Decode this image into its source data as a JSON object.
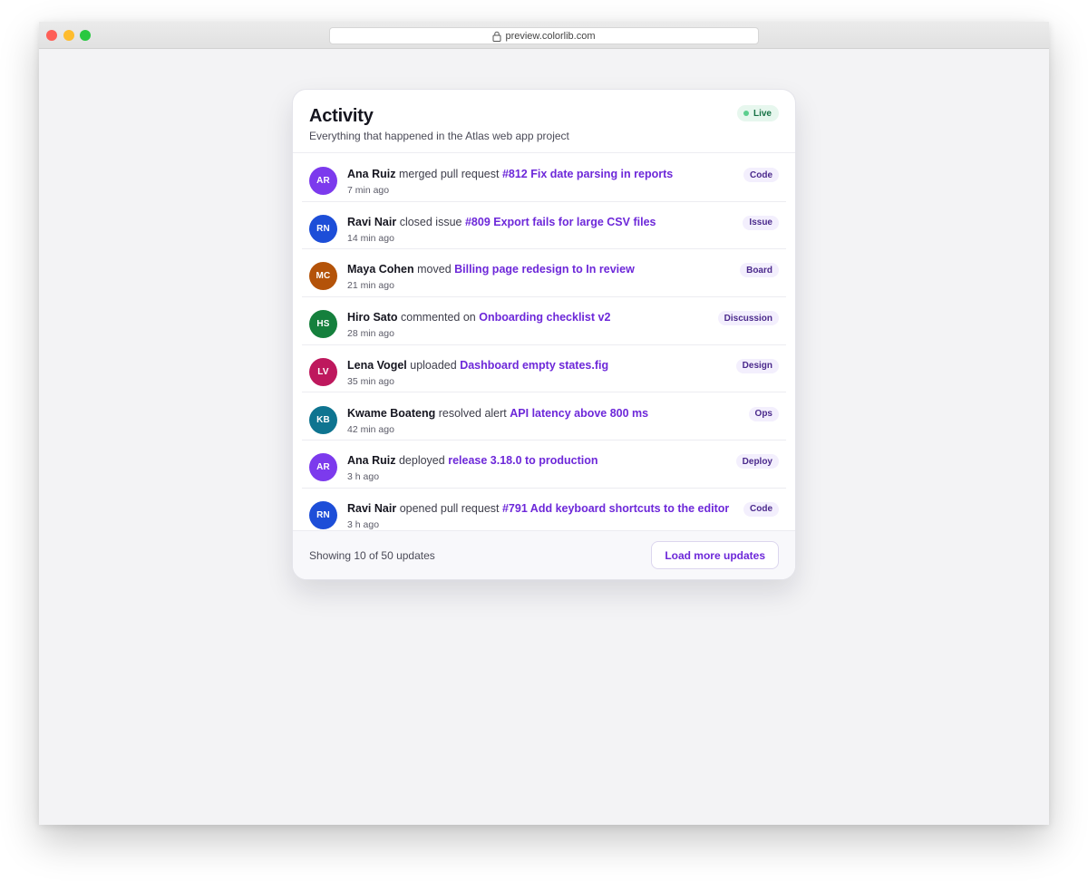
{
  "browser": {
    "url": "preview.colorlib.com"
  },
  "card": {
    "title": "Activity",
    "subtitle": "Everything that happened in the Atlas web app project",
    "live_label": "Live"
  },
  "activities": [
    {
      "initials": "AR",
      "avatar_color": "#7c3aed",
      "actor": "Ana Ruiz",
      "action": "merged pull request",
      "target": "#812 Fix date parsing in reports",
      "time": "7 min ago",
      "tag": "Code"
    },
    {
      "initials": "RN",
      "avatar_color": "#1d4ed8",
      "actor": "Ravi Nair",
      "action": "closed issue",
      "target": "#809 Export fails for large CSV files",
      "time": "14 min ago",
      "tag": "Issue"
    },
    {
      "initials": "MC",
      "avatar_color": "#b45309",
      "actor": "Maya Cohen",
      "action": "moved",
      "target": "Billing page redesign to In review",
      "time": "21 min ago",
      "tag": "Board"
    },
    {
      "initials": "HS",
      "avatar_color": "#15803d",
      "actor": "Hiro Sato",
      "action": "commented on",
      "target": "Onboarding checklist v2",
      "time": "28 min ago",
      "tag": "Discussion"
    },
    {
      "initials": "LV",
      "avatar_color": "#be185d",
      "actor": "Lena Vogel",
      "action": "uploaded",
      "target": "Dashboard empty states.fig",
      "time": "35 min ago",
      "tag": "Design"
    },
    {
      "initials": "KB",
      "avatar_color": "#0e7490",
      "actor": "Kwame Boateng",
      "action": "resolved alert",
      "target": "API latency above 800 ms",
      "time": "42 min ago",
      "tag": "Ops"
    },
    {
      "initials": "AR",
      "avatar_color": "#7c3aed",
      "actor": "Ana Ruiz",
      "action": "deployed",
      "target": "release 3.18.0 to production",
      "time": "3 h ago",
      "tag": "Deploy"
    },
    {
      "initials": "RN",
      "avatar_color": "#1d4ed8",
      "actor": "Ravi Nair",
      "action": "opened pull request",
      "target": "#791 Add keyboard shortcuts to the editor",
      "time": "3 h ago",
      "tag": "Code"
    }
  ],
  "footer": {
    "summary": "Showing 10 of 50 updates",
    "load_more_label": "Load more updates"
  }
}
